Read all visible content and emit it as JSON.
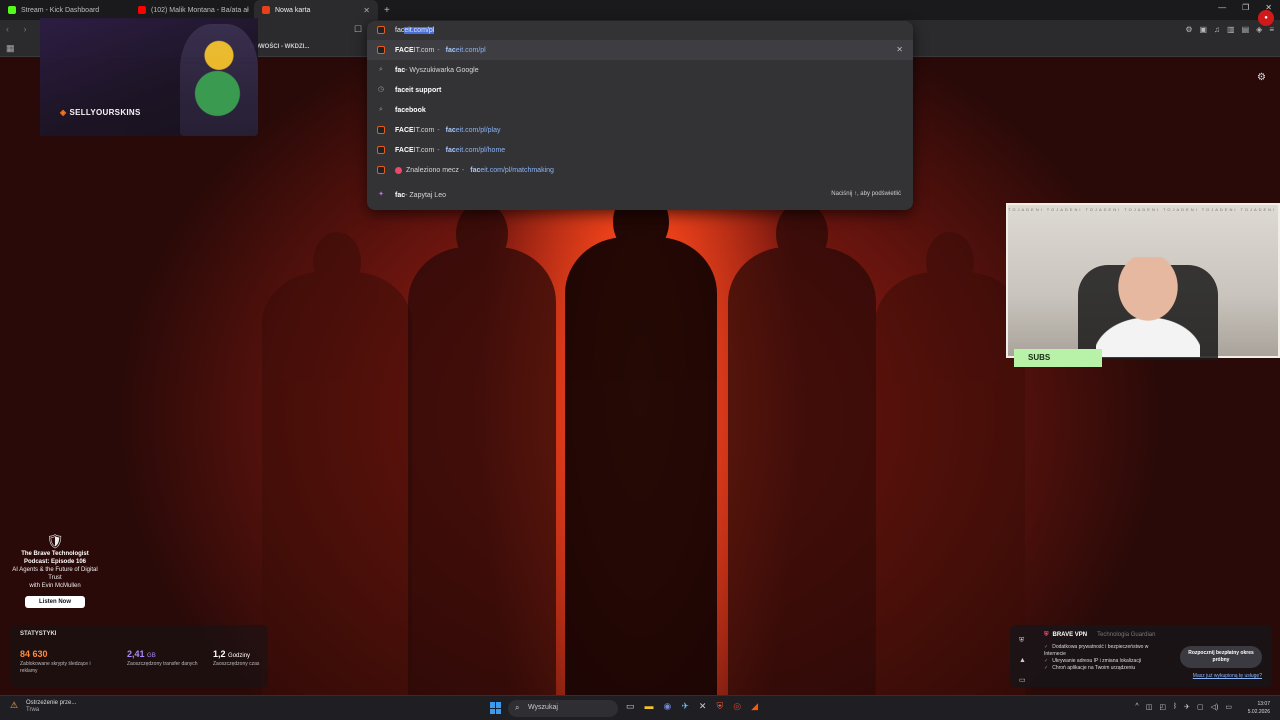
{
  "tabs": [
    {
      "title": "Stream - Kick Dashboard",
      "active": false,
      "color": "#53fc18"
    },
    {
      "title": "(102) Malik Montana - Ba/ata ał",
      "active": false,
      "color": "#ff0000"
    },
    {
      "title": "Nowa karta",
      "active": true,
      "color": "#e8401a"
    }
  ],
  "bookmarks": {
    "label": "NOWOŚCI - WKDZI..."
  },
  "omnibox": {
    "typed": "fac",
    "autocomplete": "eit.com/pl",
    "suggestions": [
      {
        "icon": "faceit-favicon",
        "bold": "FACE",
        "rest": "IT.com",
        "url_typed": "fac",
        "url_rest": "eit.com/pl",
        "highlighted": true
      },
      {
        "icon": "search-icon",
        "bold": "fac",
        "rest": " - Wyszukiwarka Google"
      },
      {
        "icon": "history-icon",
        "bold": "fac",
        "rest": "eit support"
      },
      {
        "icon": "search-icon",
        "bold": "fac",
        "rest": "ebook"
      },
      {
        "icon": "faceit-favicon",
        "bold": "FACE",
        "rest": "IT.com",
        "url_typed": "fac",
        "url_rest": "eit.com/pl/play"
      },
      {
        "icon": "faceit-favicon",
        "bold": "FACE",
        "rest": "IT.com",
        "url_typed": "fac",
        "url_rest": "eit.com/pl/home"
      },
      {
        "icon": "match-dot",
        "bold": "",
        "rest": "Znaleziono mecz",
        "url_typed": "fac",
        "url_rest": "eit.com/pl/matchmaking"
      }
    ],
    "leo": {
      "bold": "fac",
      "rest": " - Zapytaj Leo",
      "hint": "Naciśnij ↑, aby podświetlić"
    }
  },
  "stream": {
    "sponsor": "SELLYOURSKINS",
    "subs_label": "SUBS",
    "webcam_strip": "TOJADENI TOJADENI TOJADENI TOJADENI TOJADENI TOJADENI TOJADENI"
  },
  "podcast": {
    "title": "The Brave Technologist Podcast: Episode 106",
    "subtitle": "AI Agents & the Future of Digital Trust",
    "guest": "with Evin McMullen",
    "button": "Listen Now"
  },
  "stats": {
    "header": "STATYSTYKI",
    "items": [
      {
        "value": "84 630",
        "unit": "",
        "label": "Zablokowane skrypty śledzące i reklamy",
        "color": "#ff8a3d"
      },
      {
        "value": "2,41",
        "unit": "GB",
        "label": "Zaoszczędzony transfer danych",
        "color": "#a78bfa"
      },
      {
        "value": "1,2",
        "unit": "Godziny",
        "label": "Zaoszczędzony czas",
        "color": "#ffffff"
      }
    ]
  },
  "vpn": {
    "title": "BRAVE VPN",
    "provider": "Technologia Guardian",
    "features": [
      "Dodatkowa prywatność i bezpieczeństwo w Internecie",
      "Ukrywanie adresu IP i zmiana lokalizacji",
      "Chroń aplikacje na Twoim urządzeniu"
    ],
    "cta": "Rozpocznij bezpłatny okres próbny",
    "link": "Masz już wykupioną tę usługę?"
  },
  "taskbar": {
    "weather_title": "Ostrzeżenie prze...",
    "weather_sub": "Trwa",
    "search_placeholder": "Wyszukaj",
    "time": "13:07",
    "date": "5.02.2026"
  }
}
